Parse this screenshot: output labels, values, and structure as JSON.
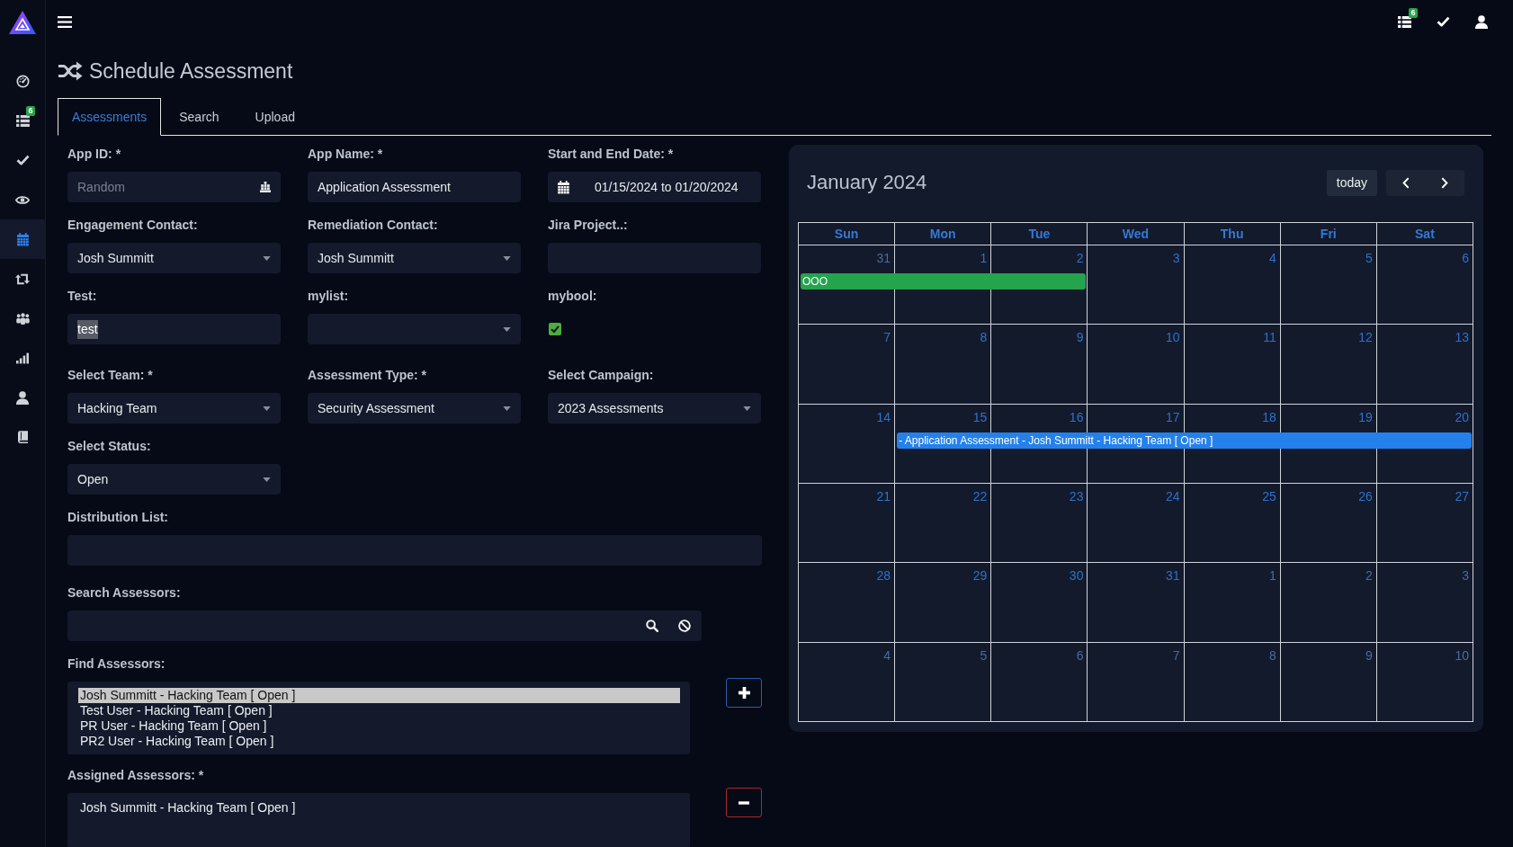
{
  "topbar": {
    "list_badge": "6"
  },
  "sidebar": {
    "items": [
      {
        "selected": false
      },
      {
        "selected": false,
        "badge": "6"
      },
      {
        "selected": false
      },
      {
        "selected": false
      },
      {
        "selected": true
      },
      {
        "selected": false
      },
      {
        "selected": false
      },
      {
        "selected": false
      },
      {
        "selected": false
      },
      {
        "selected": false
      }
    ]
  },
  "page": {
    "title": "Schedule Assessment"
  },
  "tabs": [
    {
      "label": "Assessments",
      "selected": true
    },
    {
      "label": "Search",
      "selected": false
    },
    {
      "label": "Upload",
      "selected": false
    }
  ],
  "form": {
    "rows": [
      {
        "fields": [
          {
            "kind": "generate",
            "label": "App ID: *",
            "placeholder": "Random"
          },
          {
            "kind": "text",
            "label": "App Name: *",
            "value": "Application Assessment",
            "value_highlighted": false
          },
          {
            "kind": "date",
            "label": "Start and End Date: *",
            "value": "01/15/2024 to 01/20/2024"
          }
        ]
      },
      {
        "fields": [
          {
            "kind": "select",
            "label": "Engagement Contact:",
            "value": "Josh Summitt"
          },
          {
            "kind": "select",
            "label": "Remediation Contact:",
            "value": "Josh Summitt"
          },
          {
            "kind": "text",
            "label": "Jira Project..:"
          }
        ]
      },
      {
        "fields": [
          {
            "kind": "text",
            "label": "Test:",
            "value": "test",
            "value_highlighted": true
          },
          {
            "kind": "select",
            "label": "mylist:"
          },
          {
            "kind": "checkbox",
            "label": "mybool:",
            "checked": true
          }
        ]
      },
      {
        "fields": [
          {
            "kind": "select",
            "label": "Select Team: *",
            "value": "Hacking Team"
          },
          {
            "kind": "select",
            "label": "Assessment Type: *",
            "value": "Security Assessment"
          },
          {
            "kind": "select",
            "label": "Select Campaign:",
            "value": "2023 Assessments"
          }
        ]
      },
      {
        "fields": [
          {
            "kind": "select",
            "label": "Select Status:",
            "value": "Open"
          }
        ]
      }
    ],
    "distribution_list": {
      "label": "Distribution List:"
    },
    "search_assessors": {
      "label": "Search Assessors:"
    },
    "find_assessors": {
      "label": "Find Assessors:",
      "options": [
        {
          "text": "Josh Summitt - Hacking Team [ Open ]",
          "selected": true
        },
        {
          "text": "Test User - Hacking Team [ Open ]",
          "selected": false
        },
        {
          "text": "PR User - Hacking Team [ Open ]",
          "selected": false
        },
        {
          "text": "PR2 User - Hacking Team [ Open ]",
          "selected": false
        }
      ]
    },
    "assigned_assessors": {
      "label": "Assigned Assessors: *",
      "options": [
        {
          "text": "Josh Summitt - Hacking Team [ Open ]",
          "selected": false
        }
      ]
    }
  },
  "calendar": {
    "title": "January 2024",
    "today_button": "today",
    "weekdays": [
      "Sun",
      "Mon",
      "Tue",
      "Wed",
      "Thu",
      "Fri",
      "Sat"
    ],
    "weeks": [
      {
        "days": [
          {
            "day": "31",
            "other_month": true
          },
          {
            "day": "1",
            "other_month": false
          },
          {
            "day": "2",
            "other_month": false
          },
          {
            "day": "3",
            "other_month": false
          },
          {
            "day": "4",
            "other_month": false
          },
          {
            "day": "5",
            "other_month": false
          },
          {
            "day": "6",
            "other_month": false
          }
        ],
        "events": [
          {
            "title": "OOO",
            "color": "#23a44d",
            "covers": [
              true,
              true,
              true,
              false,
              false,
              false,
              false
            ]
          }
        ]
      },
      {
        "days": [
          {
            "day": "7",
            "other_month": false
          },
          {
            "day": "8",
            "other_month": false
          },
          {
            "day": "9",
            "other_month": false
          },
          {
            "day": "10",
            "other_month": false
          },
          {
            "day": "11",
            "other_month": false
          },
          {
            "day": "12",
            "other_month": false
          },
          {
            "day": "13",
            "other_month": false
          }
        ]
      },
      {
        "days": [
          {
            "day": "14",
            "other_month": false
          },
          {
            "day": "15",
            "other_month": false
          },
          {
            "day": "16",
            "other_month": false
          },
          {
            "day": "17",
            "other_month": false
          },
          {
            "day": "18",
            "other_month": false
          },
          {
            "day": "19",
            "other_month": false
          },
          {
            "day": "20",
            "other_month": false
          }
        ],
        "events": [
          {
            "title": "- Application Assessment - Josh Summitt - Hacking Team [ Open ]",
            "color": "#2481ec",
            "covers": [
              false,
              true,
              true,
              true,
              true,
              true,
              true
            ]
          }
        ]
      },
      {
        "days": [
          {
            "day": "21",
            "other_month": false
          },
          {
            "day": "22",
            "other_month": false
          },
          {
            "day": "23",
            "other_month": false
          },
          {
            "day": "24",
            "other_month": false
          },
          {
            "day": "25",
            "other_month": false
          },
          {
            "day": "26",
            "other_month": false
          },
          {
            "day": "27",
            "other_month": false
          }
        ]
      },
      {
        "days": [
          {
            "day": "28",
            "other_month": false
          },
          {
            "day": "29",
            "other_month": false
          },
          {
            "day": "30",
            "other_month": false
          },
          {
            "day": "31",
            "other_month": false
          },
          {
            "day": "1",
            "other_month": true
          },
          {
            "day": "2",
            "other_month": true
          },
          {
            "day": "3",
            "other_month": true
          }
        ]
      },
      {
        "days": [
          {
            "day": "4",
            "other_month": true
          },
          {
            "day": "5",
            "other_month": true
          },
          {
            "day": "6",
            "other_month": true
          },
          {
            "day": "7",
            "other_month": true
          },
          {
            "day": "8",
            "other_month": true
          },
          {
            "day": "9",
            "other_month": true
          },
          {
            "day": "10",
            "other_month": true
          }
        ]
      }
    ]
  }
}
